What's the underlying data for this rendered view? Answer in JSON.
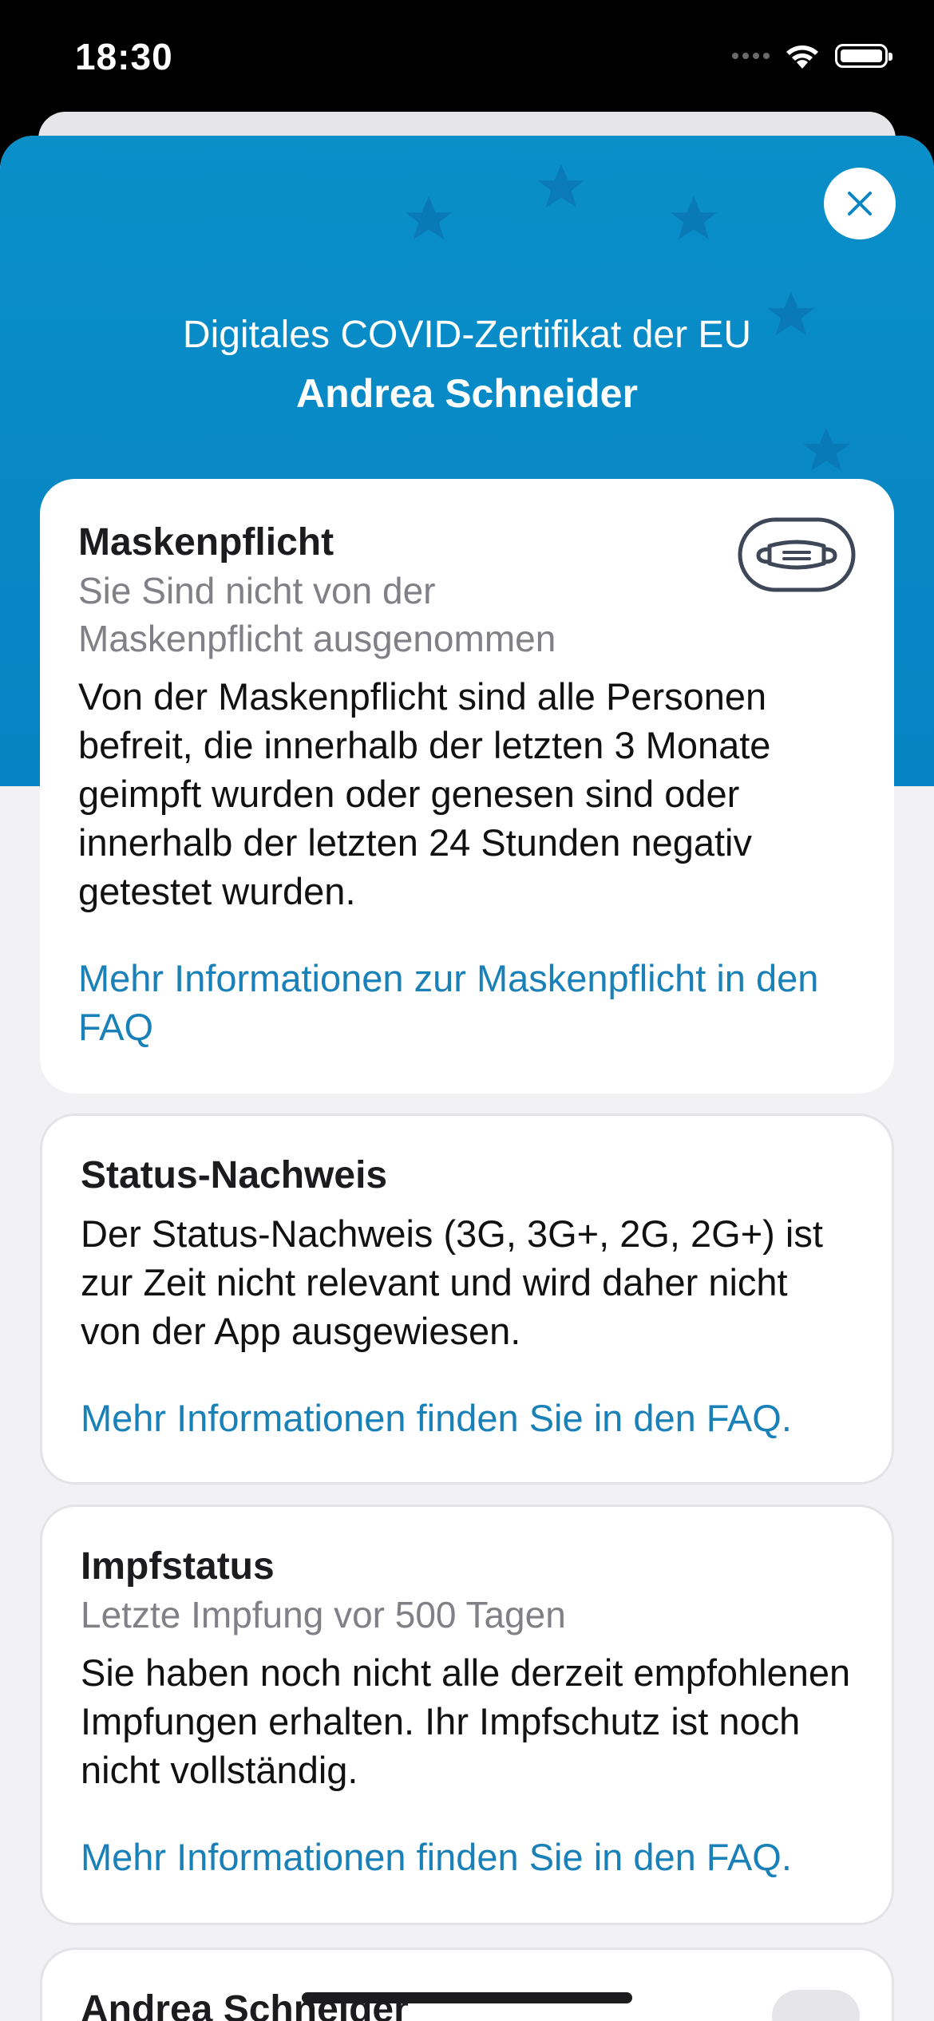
{
  "status_bar": {
    "time": "18:30",
    "icons": [
      "signal-icon",
      "wifi-icon",
      "battery-icon"
    ]
  },
  "header": {
    "title": "Digitales COVID-Zertifikat der EU",
    "name": "Andrea Schneider",
    "close_icon": "close-icon"
  },
  "colors": {
    "hero": "#0588c5",
    "link": "#1a80b8",
    "background": "#f2f2f4"
  },
  "cards": {
    "mask": {
      "title": "Maskenpflicht",
      "subtitle": "Sie Sind nicht von der Maskenpflicht ausgenommen",
      "body": "Von der Maskenpflicht sind alle Personen befreit, die innerhalb der letzten 3 Monate geimpft wurden oder genesen sind oder innerhalb der letzten 24 Stunden negativ getestet wurden.",
      "link": "Mehr Informationen zur Maskenpflicht in den FAQ",
      "icon": "mask-icon"
    },
    "status": {
      "title": "Status-Nachweis",
      "body": "Der Status-Nachweis (3G, 3G+, 2G, 2G+) ist zur Zeit nicht relevant und wird daher nicht von der App ausgewiesen.",
      "link": "Mehr Informationen finden Sie in den FAQ."
    },
    "vaccination": {
      "title": "Impfstatus",
      "subtitle": "Letzte Impfung vor 500 Tagen",
      "body": "Sie haben noch nicht alle derzeit empfohlenen Impfungen erhalten. Ihr Impfschutz ist noch nicht vollständig.",
      "link": "Mehr Informationen finden Sie in den FAQ."
    },
    "person": {
      "name": "Andrea Schneider"
    }
  }
}
